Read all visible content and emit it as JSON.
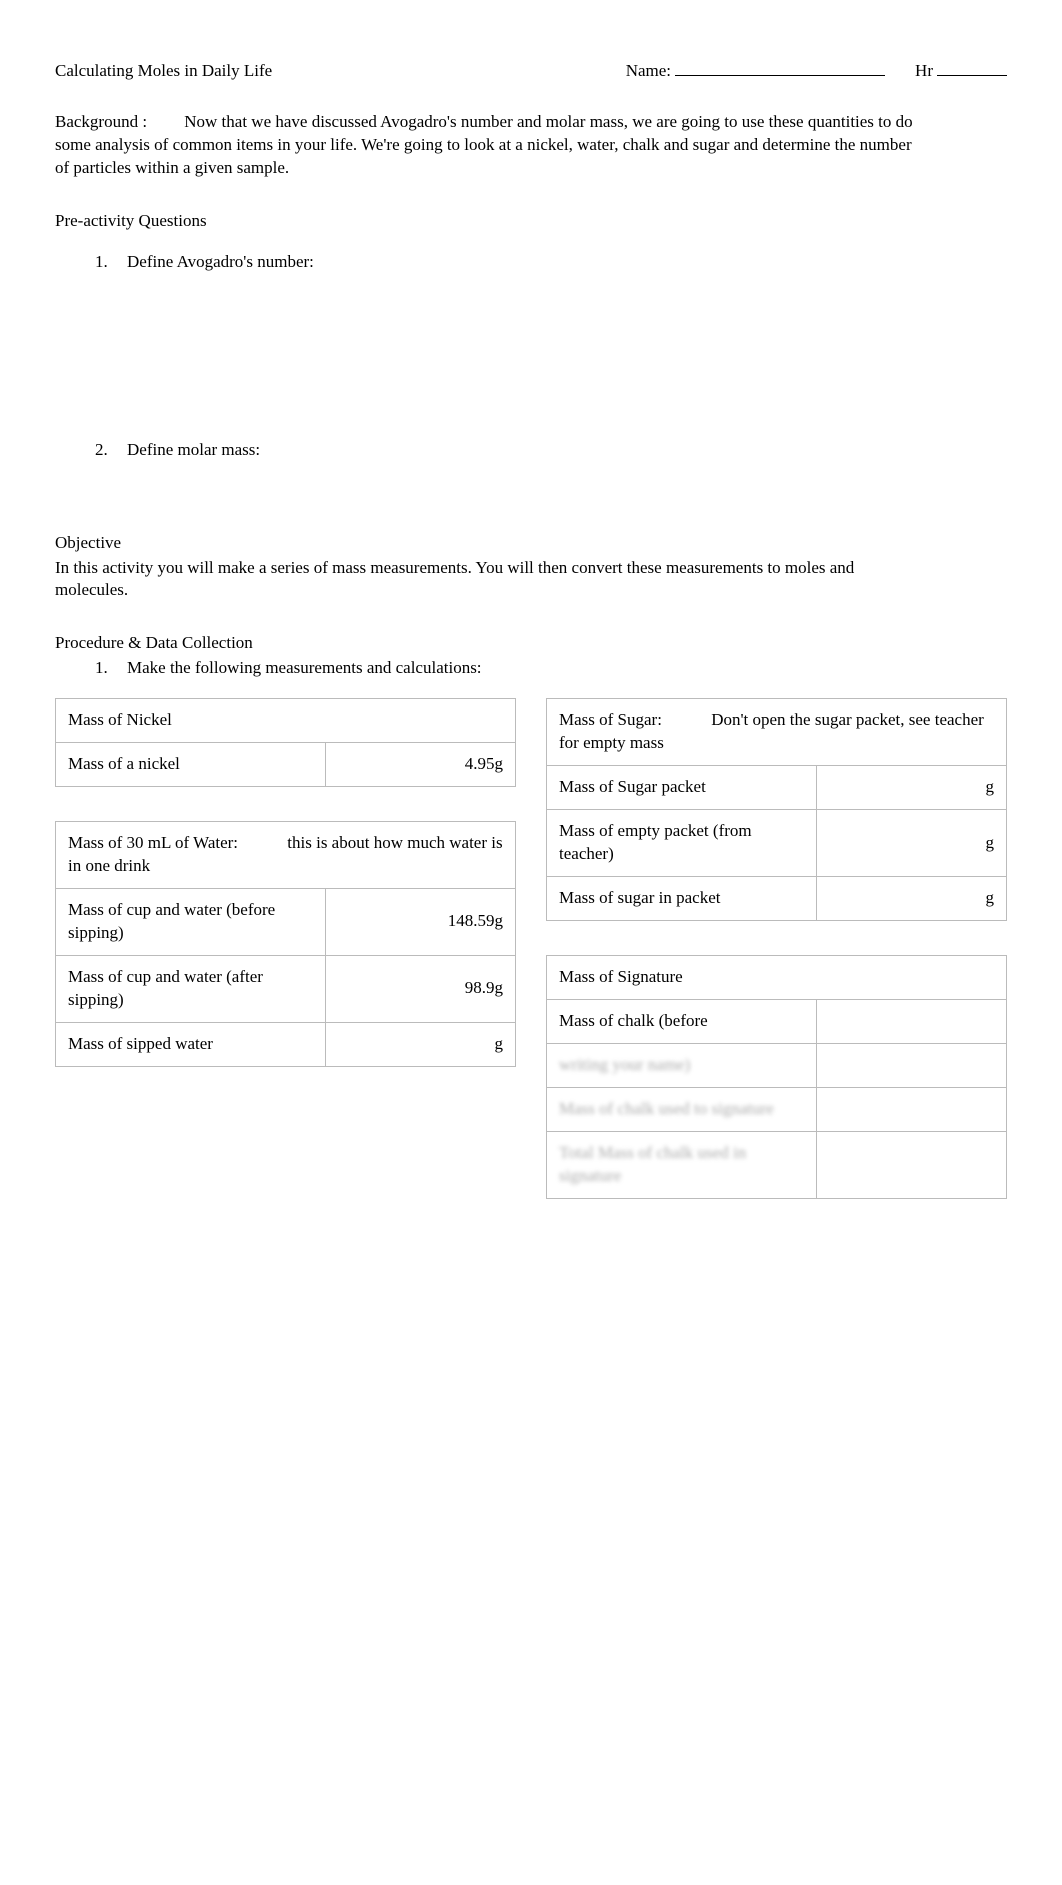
{
  "header": {
    "title": "Calculating Moles in Daily Life",
    "name_label": "Name:",
    "hr_label": "Hr"
  },
  "background": {
    "label": "Background :",
    "text": "Now that we have discussed Avogadro's number and molar mass, we are going to use these quantities to do some analysis of common items in your life. We're going to look at a nickel, water, chalk and sugar and determine the number of particles within a given sample."
  },
  "preactivity": {
    "heading": "Pre-activity Questions",
    "q1_num": "1.",
    "q1_text": "Define Avogadro's number:",
    "q2_num": "2.",
    "q2_text": "Define molar mass:"
  },
  "objective": {
    "heading": "Objective",
    "text": "In this activity you will make a series of mass measurements. You will then convert these measurements to moles and molecules."
  },
  "procedure": {
    "heading": "Procedure & Data Collection",
    "step1_num": "1.",
    "step1_text": "Make the following measurements and calculations:"
  },
  "nickel_table": {
    "header": "Mass of Nickel",
    "row1_label": "Mass of a nickel",
    "row1_value": "4.95g"
  },
  "water_table": {
    "header": "Mass of 30 mL of Water:",
    "header_note": "this is about how much water is in one drink",
    "row1_label": "Mass of cup and water (before    sipping)",
    "row1_value": "148.59g",
    "row2_label": "Mass of cup and water (after    sipping)",
    "row2_value": "98.9g",
    "row3_label": "Mass of sipped water",
    "row3_value": "g"
  },
  "sugar_table": {
    "header": "Mass of Sugar:",
    "header_note": "Don't open the sugar packet, see teacher for empty mass",
    "row1_label": "Mass of Sugar packet",
    "row1_value": "g",
    "row2_label": "Mass of empty packet (from teacher)",
    "row2_value": "g",
    "row3_label": "Mass of sugar in packet",
    "row3_value": "g"
  },
  "signature_table": {
    "header": "Mass of Signature",
    "row1_label": "Mass of chalk (before",
    "row1_value": " ",
    "blur1_label": "writing your name)",
    "blur1_value": " ",
    "blur2_label": "Mass of chalk used to signature",
    "blur2_value": " ",
    "blur3_label": "Total Mass of chalk used in signature",
    "blur3_value": " "
  }
}
